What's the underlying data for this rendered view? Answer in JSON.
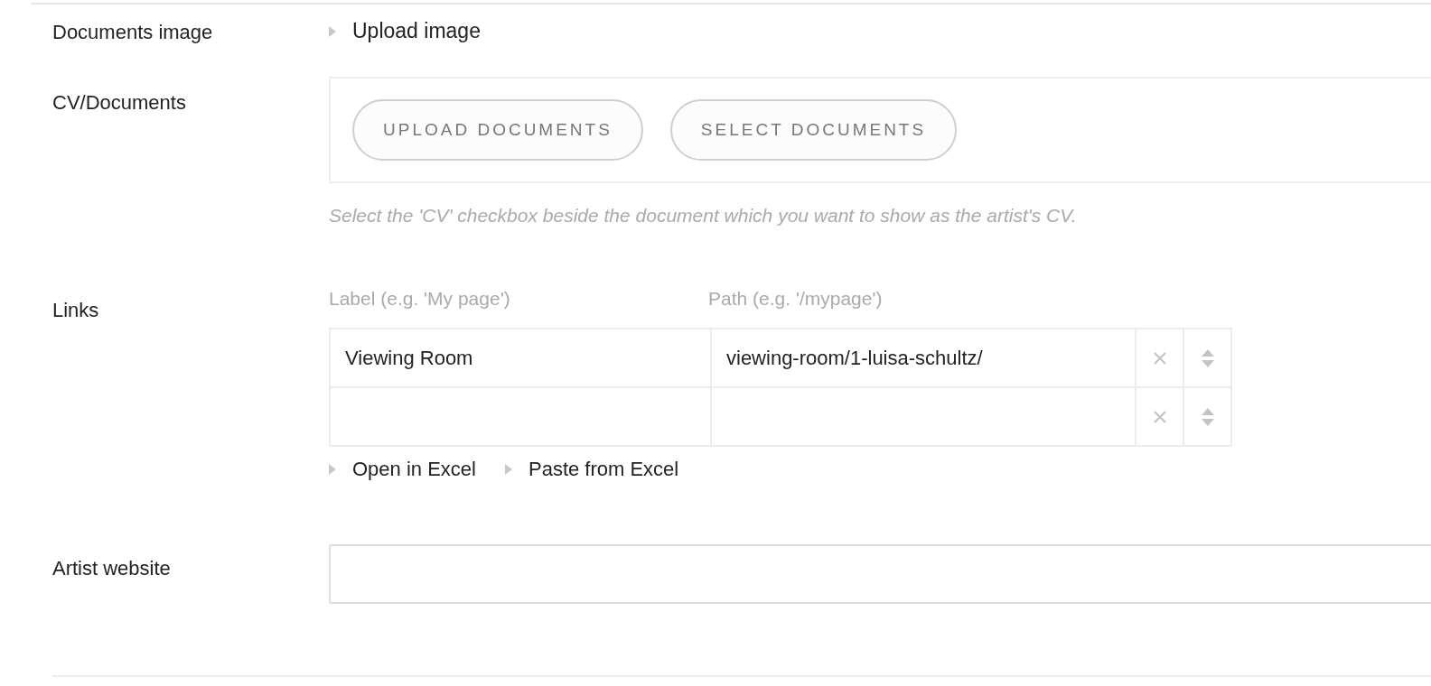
{
  "fields": [
    {
      "kind": "link",
      "label": "Documents image",
      "link": "Upload image"
    },
    {
      "kind": "buttons",
      "label": "CV/Documents",
      "buttons": [
        "UPLOAD DOCUMENTS",
        "SELECT DOCUMENTS"
      ],
      "help": "Select the 'CV' checkbox beside the document which you want to show as the artist's CV."
    },
    {
      "kind": "table",
      "label": "Links",
      "columns": [
        "Label (e.g. 'My page')",
        "Path (e.g. '/mypage')"
      ],
      "rows": [
        {
          "label": "Viewing Room",
          "path": "viewing-room/1-luisa-schultz/"
        },
        {}
      ],
      "actions": [
        "Open in Excel",
        "Paste from Excel"
      ]
    },
    {
      "kind": "input",
      "label": "Artist website"
    }
  ]
}
